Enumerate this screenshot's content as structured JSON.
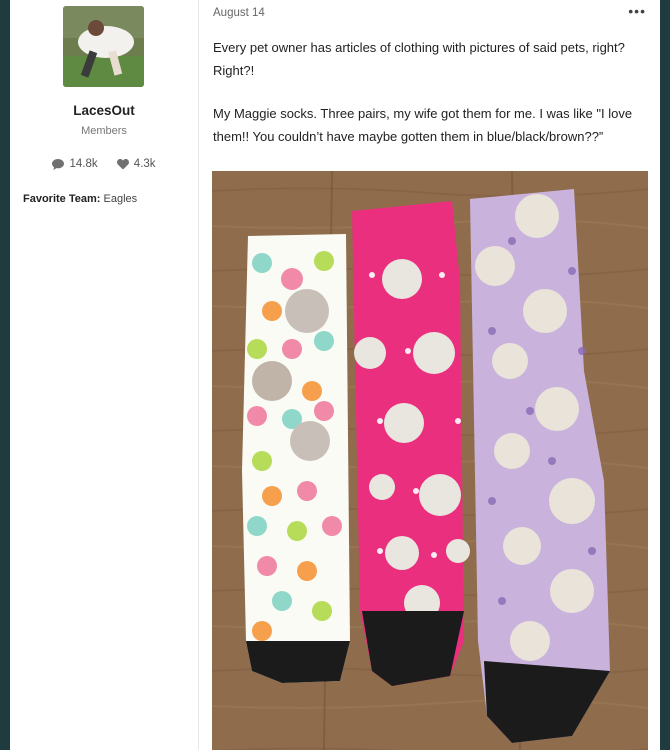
{
  "author": {
    "name": "LacesOut",
    "group": "Members",
    "posts_count": "14.8k",
    "reputation": "4.3k",
    "favorite_team_label": "Favorite Team:",
    "favorite_team_value": "Eagles"
  },
  "post": {
    "date": "August 14",
    "more_icon": "more-icon",
    "paragraph1": "Every pet owner has articles of clothing with pictures of said pets, right? Right?!",
    "paragraph2": "My Maggie socks. Three pairs, my wife got them for me. I was like \"I love them!! You couldn’t have maybe gotten them in blue/black/brown??”"
  },
  "photo": {
    "icon": "photo-image",
    "colors": {
      "floor": "#8a6a4a",
      "sock1": "#fbfbf6",
      "sock2": "#ea2f7e",
      "sock3": "#c9b3dc",
      "toe": "#1b1b1b"
    }
  }
}
